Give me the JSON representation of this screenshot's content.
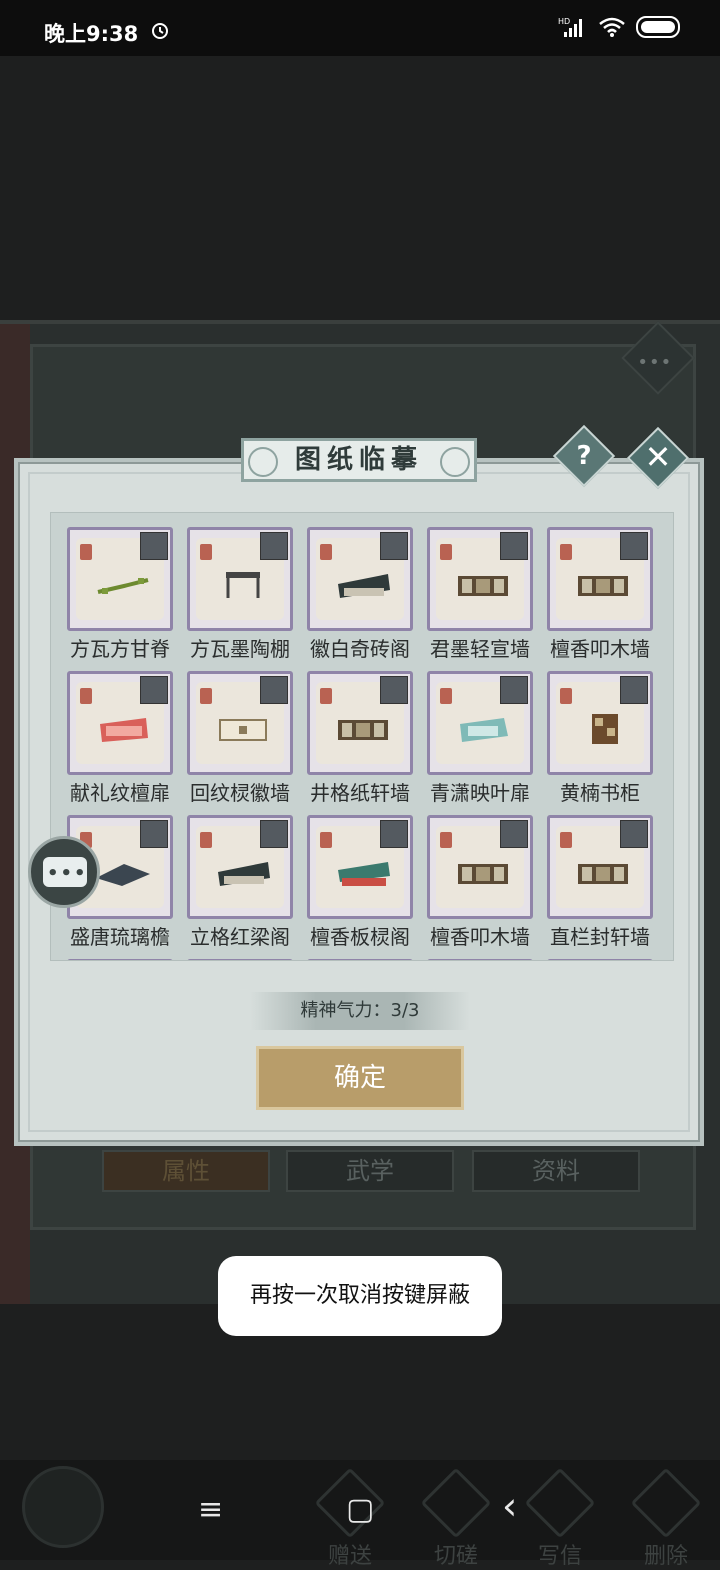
{
  "status_bar": {
    "time": "晚上9:38",
    "network": "HD"
  },
  "background": {
    "tabs": [
      "属性",
      "武学",
      "资料"
    ],
    "more_dots": "•••",
    "bottom_actions": [
      "赠送",
      "切磋",
      "写信",
      "删除"
    ]
  },
  "dialog": {
    "title": "图纸临摹",
    "help_label": "?",
    "close_label": "✕",
    "items": [
      {
        "name": "方瓦方甘脊",
        "thumb": "ridge"
      },
      {
        "name": "方瓦墨陶棚",
        "thumb": "pergola"
      },
      {
        "name": "徽白奇砖阁",
        "thumb": "roof"
      },
      {
        "name": "君墨轻宣墙",
        "thumb": "wall"
      },
      {
        "name": "檀香叩木墙",
        "thumb": "wall"
      },
      {
        "name": "献礼纹檀扉",
        "thumb": "red-house"
      },
      {
        "name": "回纹棂徽墙",
        "thumb": "panel"
      },
      {
        "name": "井格纸轩墙",
        "thumb": "wall"
      },
      {
        "name": "青潇映叶扉",
        "thumb": "teal-house"
      },
      {
        "name": "黄楠书柜",
        "thumb": "cabinet"
      },
      {
        "name": "盛唐琉璃檐",
        "thumb": "eave"
      },
      {
        "name": "立格红梁阁",
        "thumb": "roof"
      },
      {
        "name": "檀香板棂阁",
        "thumb": "green-roof"
      },
      {
        "name": "檀香叩木墙",
        "thumb": "wall"
      },
      {
        "name": "直栏封轩墙",
        "thumb": "wall"
      }
    ],
    "stamina_label": "精神气力：3/3",
    "confirm_label": "确定"
  },
  "toast": "再按一次取消按键屏蔽",
  "nav": {
    "menu": "≡",
    "home": "▢",
    "back": "‹"
  },
  "colors": {
    "card_border": "#8f84a8",
    "confirm": "#b89d6a",
    "modal_bg": "#d7dedc"
  }
}
